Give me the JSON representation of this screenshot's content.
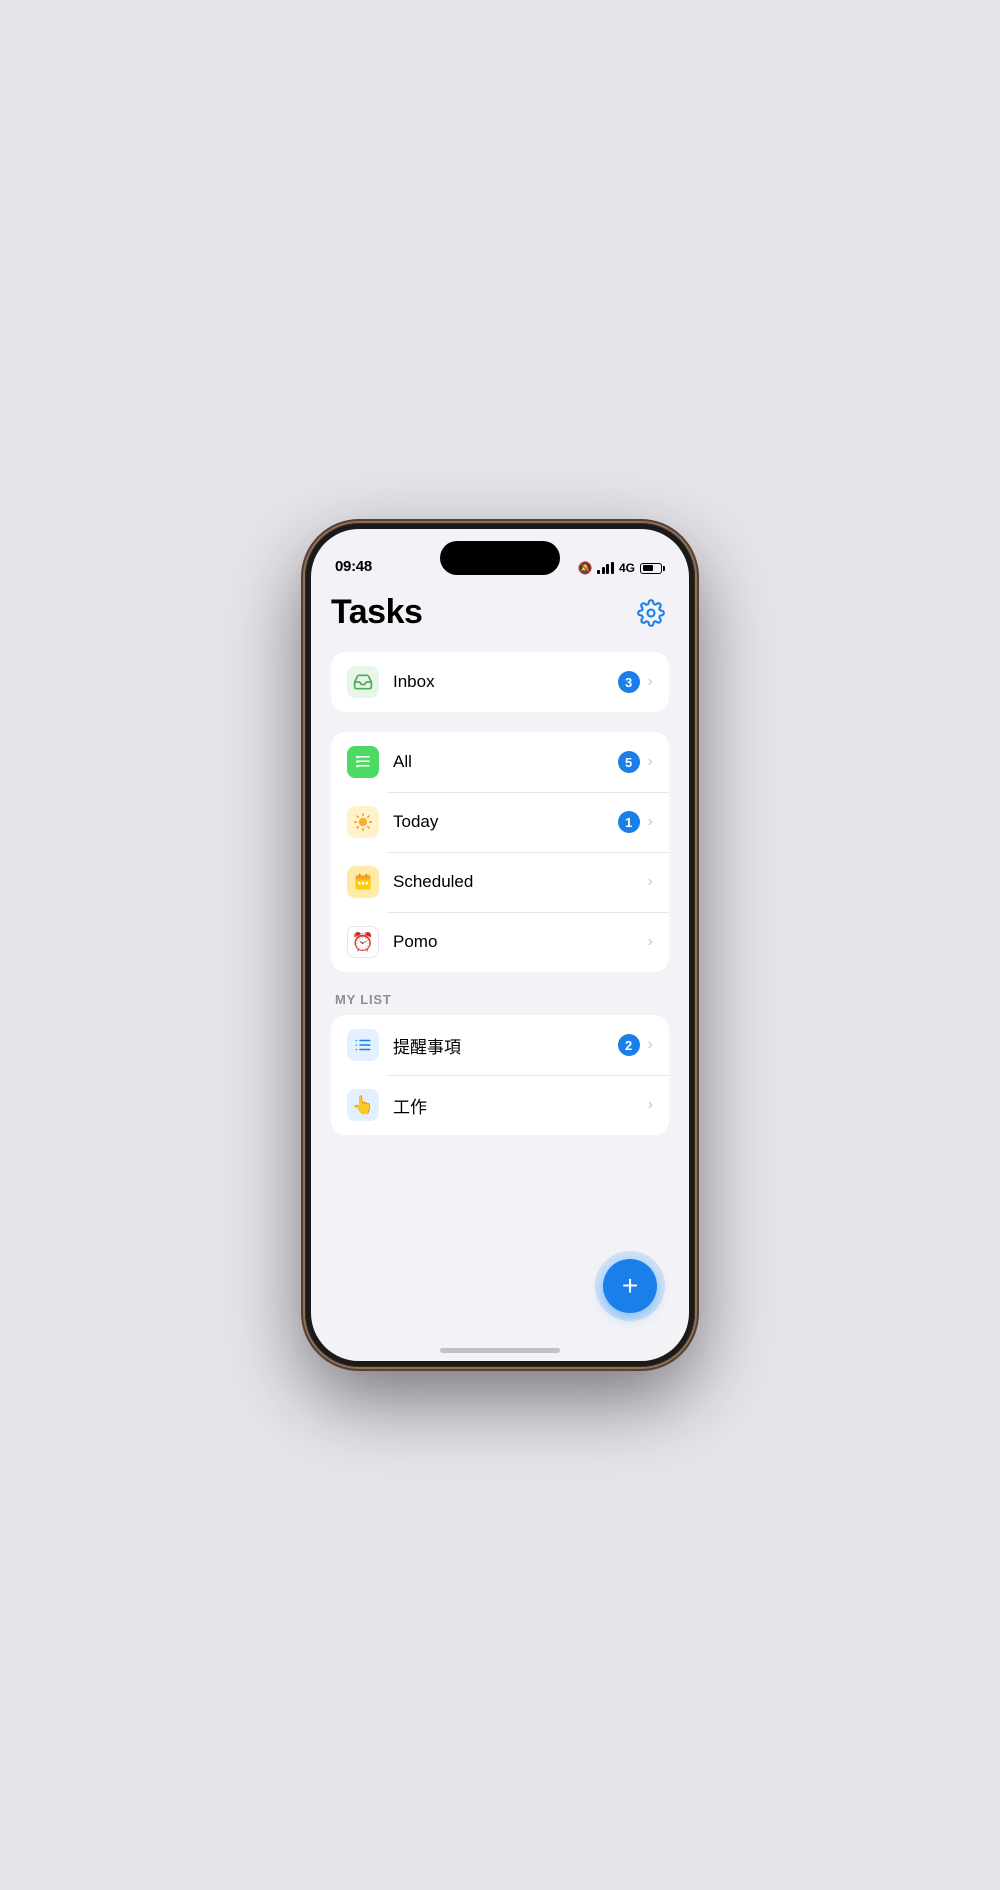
{
  "status_bar": {
    "time": "09:48",
    "network": "4G",
    "bell_symbol": "🔕"
  },
  "header": {
    "title": "Tasks",
    "settings_label": "Settings"
  },
  "inbox_section": {
    "items": [
      {
        "id": "inbox",
        "label": "Inbox",
        "badge": "3",
        "has_badge": true,
        "icon_type": "inbox"
      }
    ]
  },
  "main_section": {
    "items": [
      {
        "id": "all",
        "label": "All",
        "badge": "5",
        "has_badge": true,
        "icon_type": "all"
      },
      {
        "id": "today",
        "label": "Today",
        "badge": "1",
        "has_badge": true,
        "icon_type": "today"
      },
      {
        "id": "scheduled",
        "label": "Scheduled",
        "badge": "",
        "has_badge": false,
        "icon_type": "scheduled"
      },
      {
        "id": "pomo",
        "label": "Pomo",
        "badge": "",
        "has_badge": false,
        "icon_type": "pomo"
      }
    ]
  },
  "my_list_section": {
    "header": "MY LIST",
    "items": [
      {
        "id": "reminders",
        "label": "提醒事項",
        "badge": "2",
        "has_badge": true,
        "icon_type": "list1"
      },
      {
        "id": "work",
        "label": "工作",
        "badge": "",
        "has_badge": false,
        "icon_type": "list2"
      }
    ]
  },
  "fab": {
    "label": "Add Task",
    "symbol": "+"
  }
}
